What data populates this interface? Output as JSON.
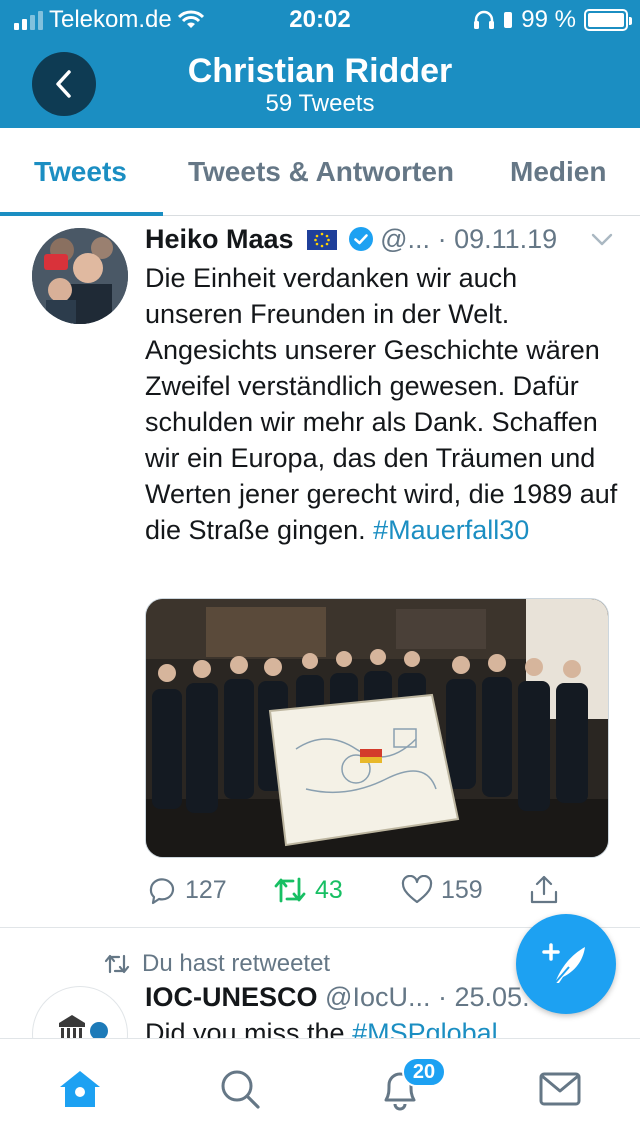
{
  "status_bar": {
    "carrier": "Telekom.de",
    "time": "20:02",
    "battery": "99 %",
    "battery_level": 0.99
  },
  "header": {
    "title": "Christian Ridder",
    "subtitle": "59 Tweets"
  },
  "tabs": [
    {
      "label": "Tweets",
      "active": true
    },
    {
      "label": "Tweets & Antworten",
      "active": false
    },
    {
      "label": "Medien",
      "active": false
    }
  ],
  "tweet": {
    "author": "Heiko Maas",
    "handle": "@...",
    "separator": "·",
    "date": "09.11.19",
    "text": "Die Einheit verdanken wir auch unseren Freunden in der Welt. Angesichts unserer Geschichte wären Zweifel verständlich gewesen. Dafür schulden wir mehr als Dank. Schaffen wir ein Europa, das den Träumen und Werten jener gerecht wird, die 1989 auf die Straße gingen. ",
    "hashtag": "#Mauerfall30",
    "replies": "127",
    "retweets": "43",
    "likes": "159"
  },
  "tweet2": {
    "retweet_label": "Du hast retweetet",
    "author": "IOC-UNESCO",
    "handle": "@IocU...",
    "separator": "·",
    "date": "25.05.",
    "text": "Did you miss the ",
    "hashtag": "#MSPglobal"
  },
  "bottom_nav": {
    "notifications_badge": "20"
  },
  "colors": {
    "header_bg": "#1b8ec2",
    "accent": "#1da1f2",
    "retweet_green": "#17bf63"
  }
}
